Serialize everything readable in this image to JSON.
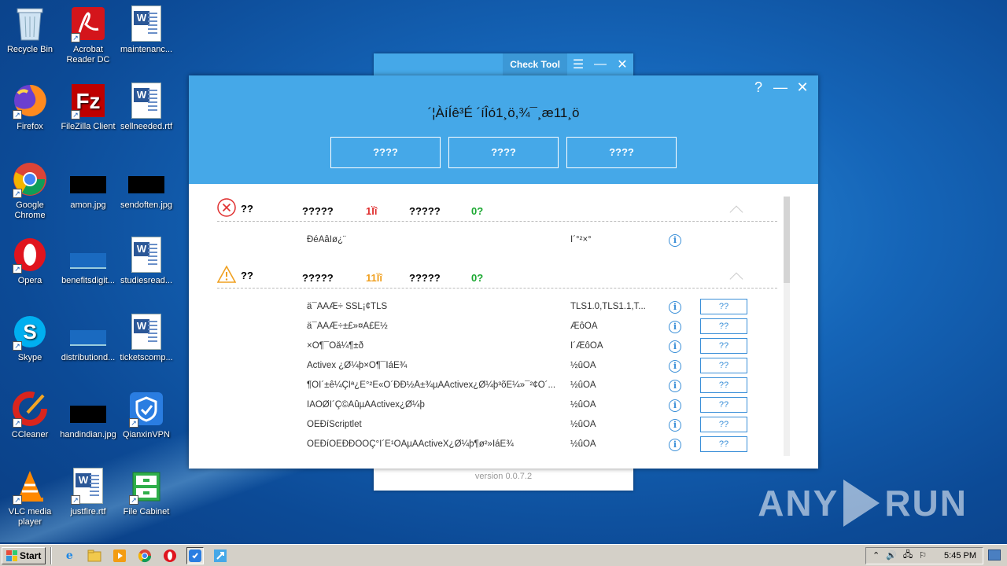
{
  "desktop": {
    "icons": [
      {
        "label": "Recycle Bin",
        "icon": "recycle-bin-icon"
      },
      {
        "label": "Acrobat Reader DC",
        "icon": "acrobat-icon"
      },
      {
        "label": "maintenanc...",
        "icon": "word-doc-icon"
      },
      {
        "label": "Firefox",
        "icon": "firefox-icon"
      },
      {
        "label": "FileZilla Client",
        "icon": "filezilla-icon"
      },
      {
        "label": "sellneeded.rtf",
        "icon": "word-doc-icon"
      },
      {
        "label": "Google Chrome",
        "icon": "chrome-icon"
      },
      {
        "label": "amon.jpg",
        "icon": "image-thumb-icon"
      },
      {
        "label": "sendoften.jpg",
        "icon": "image-thumb-icon"
      },
      {
        "label": "Opera",
        "icon": "opera-icon"
      },
      {
        "label": "benefitsdigit...",
        "icon": "image-thumb-icon"
      },
      {
        "label": "studiesread...",
        "icon": "word-doc-icon"
      },
      {
        "label": "Skype",
        "icon": "skype-icon"
      },
      {
        "label": "distributiond...",
        "icon": "image-thumb-icon"
      },
      {
        "label": "ticketscomp...",
        "icon": "word-doc-icon"
      },
      {
        "label": "CCleaner",
        "icon": "ccleaner-icon"
      },
      {
        "label": "handindian.jpg",
        "icon": "image-thumb-icon"
      },
      {
        "label": "QianxinVPN",
        "icon": "vpn-icon"
      },
      {
        "label": "VLC media player",
        "icon": "vlc-icon"
      },
      {
        "label": "justfire.rtf",
        "icon": "word-doc-icon"
      },
      {
        "label": "File Cabinet",
        "icon": "file-cabinet-icon"
      }
    ]
  },
  "back_window": {
    "title": "Check Tool",
    "version": "version 0.0.7.2"
  },
  "main_window": {
    "title": "´¦ÀíÍê³É ´íÎó1¸ö,¾¯¸æ11¸ö",
    "buttons": [
      "????",
      "????",
      "????"
    ],
    "sections": [
      {
        "name": "??",
        "col1": "?????",
        "count1": "1Ïî",
        "col2": "?????",
        "count2": "0?",
        "rows": [
          {
            "name": "ÐéÄâÍø¿¨",
            "value": "Î´°²×°"
          }
        ]
      },
      {
        "name": "??",
        "col1": "?????",
        "count1": "11Ïî",
        "col2": "?????",
        "count2": "0?",
        "rows": [
          {
            "name": "ä¯ÀÀÆ÷ SSL¡¢TLS",
            "value": "TLS1.0,TLS1.1,T...",
            "fix": "??"
          },
          {
            "name": "ä¯ÀÀÆ÷±£»¤Ä£Ê½",
            "value": "ÆôÓÃ",
            "fix": "??"
          },
          {
            "name": "×Ô¶¯Òå¼¶±ð",
            "value": "Î´ÆôÓÃ",
            "fix": "??"
          },
          {
            "name": "Activex ¿Ø¼þ×Ô¶¯ÌáÊ¾",
            "value": "½ûÓÃ",
            "fix": "??"
          },
          {
            "name": "¶ÔÎ´±ê¼ÇÎª¿É°²È«Ö´ÐÐ½Å±¾µÄActivex¿Ø¼þ³õÊ¼»¯²¢Ö´...",
            "value": "½ûÓÃ",
            "fix": "??"
          },
          {
            "name": "ÏÂÔØÎ´Ç©ÃûµÄActivex¿Ø¼þ",
            "value": "½ûÓÃ",
            "fix": "??"
          },
          {
            "name": "ÔÊÐíScriptlet",
            "value": "½ûÓÃ",
            "fix": "??"
          },
          {
            "name": "ÔÊÐíÔËÐÐÒÔÇ°Î´Ê¹ÓÃµÄActiveX¿Ø¼þ¶ø²»ÌáÊ¾",
            "value": "½ûÓÃ",
            "fix": "??"
          }
        ]
      }
    ]
  },
  "watermark": {
    "left": "ANY",
    "right": "RUN"
  },
  "taskbar": {
    "start_label": "Start",
    "clock": "5:45 PM",
    "quick_launch": [
      "ie-icon",
      "explorer-icon",
      "media-player-icon",
      "chrome-icon",
      "opera-icon",
      "vpn-icon",
      "check-tool-icon"
    ]
  },
  "colors": {
    "accent": "#45a8e8",
    "error": "#e03030",
    "warning": "#f0a020",
    "ok": "#1aa830"
  }
}
